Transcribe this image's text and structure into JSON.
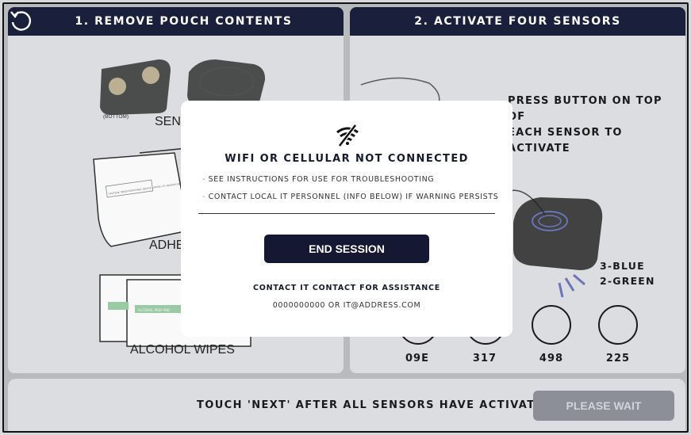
{
  "panels": {
    "left": {
      "title": "1. REMOVE POUCH CONTENTS"
    },
    "right": {
      "title": "2. ACTIVATE FOUR SENSORS"
    }
  },
  "left_content": {
    "bottom_label": "(BOTTOM)",
    "sensors_label": "SENS",
    "adhesive_label": "ADHE",
    "wipes_label": "ALCOHOL WIPES",
    "pouch_caution": "CAUTION: INVESTIGATIONAL DEVICE LIMITED TO INVESTIGATIONAL USE",
    "wipe_label": "ALCOHOL PREP PAD"
  },
  "right_content": {
    "instruction_line1": "PRESS BUTTON ON TOP OF",
    "instruction_line2": "EACH SENSOR TO ACTIVATE",
    "count_line1": "3-BLUE",
    "count_line2": "2-GREEN",
    "sensors": [
      "09E",
      "317",
      "498",
      "225"
    ]
  },
  "footer": {
    "message": "TOUCH 'NEXT' AFTER ALL SENSORS HAVE ACTIVATED",
    "wait_button": "PLEASE WAIT"
  },
  "modal": {
    "icon": "wifi-off-icon",
    "title": "WIFI OR CELLULAR NOT CONNECTED",
    "line1": "SEE INSTRUCTIONS FOR USE FOR TROUBLESHOOTING",
    "line2": "CONTACT LOCAL IT PERSONNEL (INFO BELOW) IF WARNING PERSISTS",
    "end_button": "END SESSION",
    "contact_title": "CONTACT IT CONTACT FOR ASSISTANCE",
    "contact_info": "0000000000 OR IT@ADDRESS.COM"
  },
  "colors": {
    "header": "#1a1f3c",
    "panel": "#dcdde0",
    "overlay": "#b9babd",
    "button_disabled": "#8c8e98",
    "accent_dash": "#d98a3a",
    "sensor_blue": "#6a74b8"
  }
}
